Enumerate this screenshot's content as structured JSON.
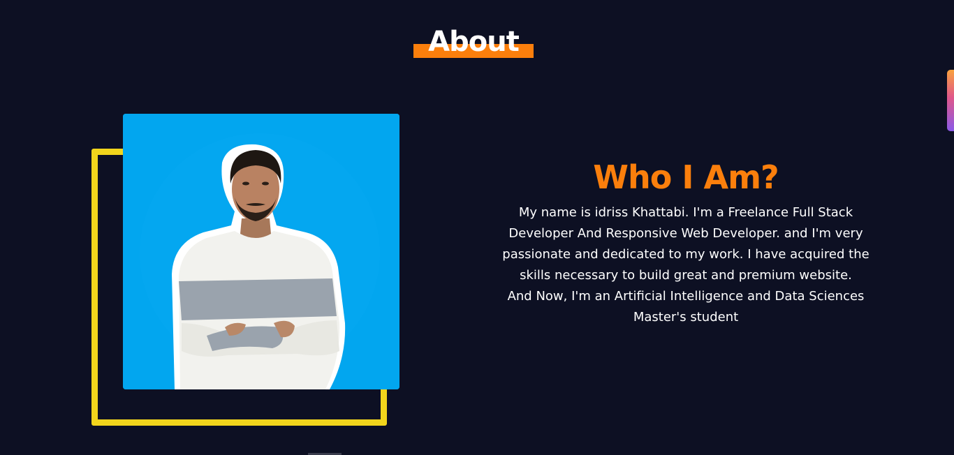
{
  "section": {
    "title": "About"
  },
  "about": {
    "heading": "Who I Am?",
    "bio_paragraph_1": "My name is idriss Khattabi. I'm a Freelance Full Stack Developer And Responsive Web Developer. and I'm very passionate and dedicated to my work. I have acquired the skills necessary to build great and premium website.",
    "bio_paragraph_2": "And Now, I'm an Artificial Intelligence and Data Sciences Master's student"
  },
  "colors": {
    "background": "#0d1023",
    "accent_orange": "#fb7f0c",
    "frame_yellow": "#f2d51c",
    "photo_blue": "#02a6ef",
    "text_white": "#ffffff"
  },
  "icons": {
    "profile_photo": "portrait-photo"
  }
}
